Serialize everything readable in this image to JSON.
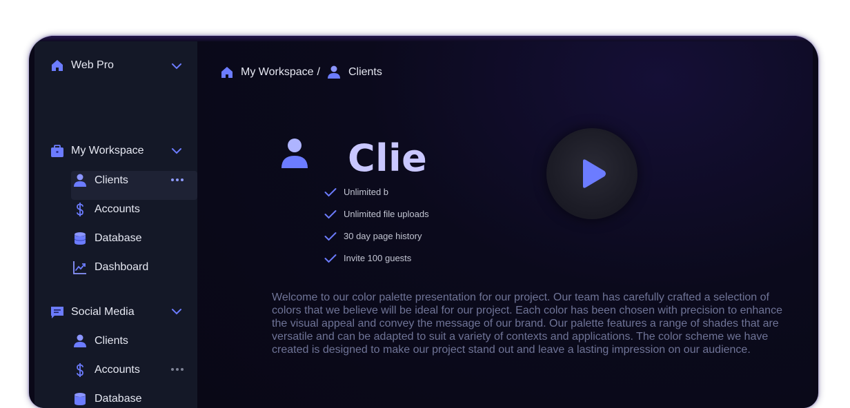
{
  "sidebar": {
    "workspace_switcher": {
      "label": "Web Pro"
    },
    "sections": [
      {
        "label": "My Workspace",
        "items": [
          {
            "label": "Clients",
            "icon": "user-icon",
            "active": true
          },
          {
            "label": "Accounts",
            "icon": "dollar-icon"
          },
          {
            "label": "Database",
            "icon": "database-icon"
          },
          {
            "label": "Dashboard",
            "icon": "chart-icon"
          }
        ]
      },
      {
        "label": "Social Media",
        "items": [
          {
            "label": "Clients",
            "icon": "user-icon"
          },
          {
            "label": "Accounts",
            "icon": "dollar-icon"
          },
          {
            "label": "Database",
            "icon": "database-icon"
          }
        ]
      }
    ]
  },
  "breadcrumb": {
    "root": "My Workspace",
    "separator": "/",
    "current": "Clients"
  },
  "hero": {
    "title": "Clie",
    "features": [
      "Unlimited b",
      "Unlimited file uploads",
      "30 day page history",
      "Invite 100 guests"
    ],
    "description": "Welcome to our color palette presentation for our project. Our team has carefully crafted a selection of colors that we believe will be ideal for our project. Each color has been chosen with precision to enhance the visual appeal and convey the message of our brand. Our palette features a range of shades that are versatile and can be adapted to suit a variety of contexts and applications. The color scheme we have created is designed to make our project stand out and leave a lasting impression on our audience."
  },
  "colors": {
    "accent": "#6c7cff",
    "sidebar_bg": "#141827",
    "main_bg": "#0a0818",
    "title": "#c9c7ff"
  }
}
